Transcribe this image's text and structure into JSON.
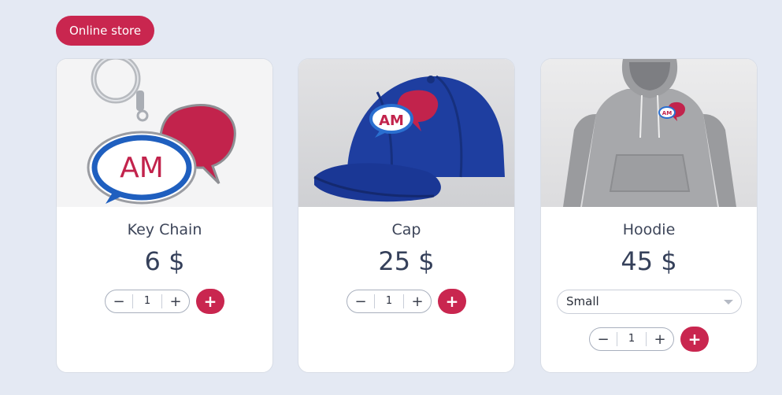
{
  "header": {
    "store_label": "Online store"
  },
  "products": [
    {
      "name": "Key Chain",
      "price": "6 $",
      "quantity": "1",
      "image": "am-keychain-image",
      "decrement_icon": "minus-icon",
      "increment_icon": "plus-icon",
      "add_icon": "plus-icon"
    },
    {
      "name": "Cap",
      "price": "25 $",
      "quantity": "1",
      "image": "am-cap-image",
      "decrement_icon": "minus-icon",
      "increment_icon": "plus-icon",
      "add_icon": "plus-icon"
    },
    {
      "name": "Hoodie",
      "price": "45 $",
      "quantity": "1",
      "image": "am-hoodie-image",
      "size_selected": "Small",
      "decrement_icon": "minus-icon",
      "increment_icon": "plus-icon",
      "add_icon": "plus-icon"
    }
  ],
  "glyphs": {
    "minus": "−",
    "plus": "+"
  },
  "colors": {
    "accent": "#c9264f",
    "background": "#e4e9f3",
    "text": "#35405a"
  },
  "logo_text": "AM"
}
